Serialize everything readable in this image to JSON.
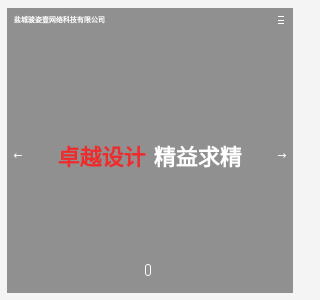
{
  "header": {
    "site_title": "盐城骏姿壹网络科技有限公司",
    "menu_icon": "hamburger-menu-icon"
  },
  "hero": {
    "headline_highlight": "卓越设计",
    "headline_rest": "精益求精",
    "prev_arrow": "←",
    "next_arrow": "→",
    "scroll_icon": "mouse-scroll-icon"
  },
  "colors": {
    "hero_background": "#909090",
    "accent": "#ef2b2b",
    "text_light": "#ffffff",
    "page_background": "#f4f4f4"
  }
}
